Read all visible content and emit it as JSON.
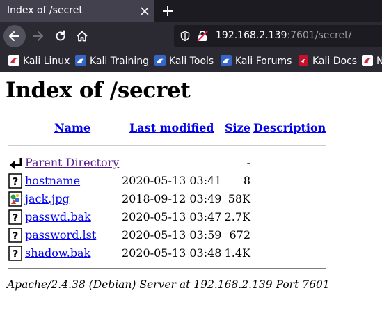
{
  "tab": {
    "title": "Index of /secret"
  },
  "urlbar": {
    "host": "192.168.2.139",
    "path": ":7601/secret/"
  },
  "bookmarks": [
    {
      "label": "Kali Linux",
      "icon": "kali-dragon-icon"
    },
    {
      "label": "Kali Training",
      "icon": "kali-training-icon"
    },
    {
      "label": "Kali Tools",
      "icon": "kali-tools-icon"
    },
    {
      "label": "Kali Forums",
      "icon": "kali-forums-icon"
    },
    {
      "label": "Kali Docs",
      "icon": "kali-docs-icon"
    },
    {
      "label": "N",
      "icon": "kali-nethunter-icon"
    }
  ],
  "page": {
    "title": "Index of /secret",
    "headers": {
      "name": "Name",
      "modified": "Last modified",
      "size": "Size",
      "description": "Description"
    },
    "parent": {
      "name": "Parent Directory",
      "size": "-"
    },
    "files": [
      {
        "name": "hostname",
        "modified": "2020-05-13 03:41",
        "size": "8",
        "icon": "unknown-file-icon"
      },
      {
        "name": "jack.jpg",
        "modified": "2018-09-12 03:49",
        "size": "58K",
        "icon": "image-file-icon"
      },
      {
        "name": "passwd.bak",
        "modified": "2020-05-13 03:47",
        "size": "2.7K",
        "icon": "unknown-file-icon"
      },
      {
        "name": "password.lst",
        "modified": "2020-05-13 03:59",
        "size": "672",
        "icon": "unknown-file-icon"
      },
      {
        "name": "shadow.bak",
        "modified": "2020-05-13 03:48",
        "size": "1.4K",
        "icon": "unknown-file-icon"
      }
    ],
    "address": "Apache/2.4.38 (Debian) Server at 192.168.2.139 Port 7601"
  },
  "colors": {
    "link": "#0000ee",
    "visited": "#551a8b",
    "chrome_dark": "#1c1b22",
    "chrome": "#2b2a33"
  }
}
